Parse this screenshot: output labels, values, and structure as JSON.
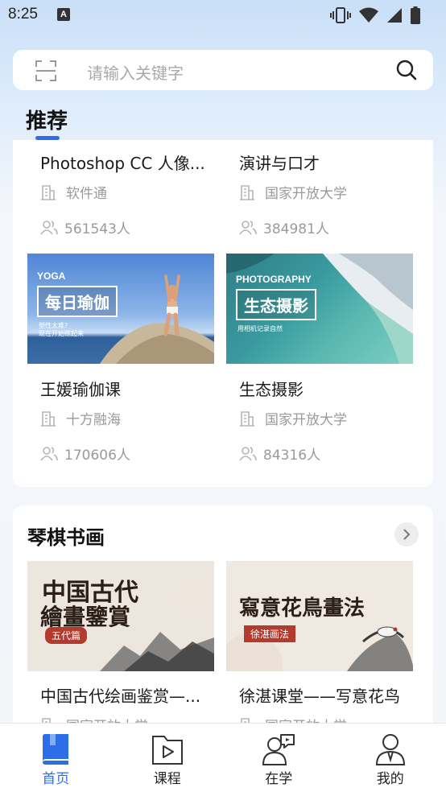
{
  "status_bar": {
    "time": "8:25",
    "notification_badge": "A"
  },
  "search": {
    "placeholder": "请输入关键字"
  },
  "recommend": {
    "title": "推荐",
    "courses": [
      {
        "title": "Photoshop CC 人像...",
        "provider": "软件通",
        "learners": "561543人"
      },
      {
        "title": "演讲与口才",
        "provider": "国家开放大学",
        "learners": "384981人"
      },
      {
        "title": "王媛瑜伽课",
        "provider": "十方融海",
        "learners": "170606人",
        "thumb": {
          "tag": "YOGA",
          "headline": "每日瑜伽",
          "sub1": "塑性太难?",
          "sub2": "现在开始练起来"
        }
      },
      {
        "title": "生态摄影",
        "provider": "国家开放大学",
        "learners": "84316人",
        "thumb": {
          "tag": "PHOTOGRAPHY",
          "headline": "生态摄影",
          "sub1": "用相机记录自然"
        }
      }
    ]
  },
  "qinqi": {
    "title": "琴棋书画",
    "courses": [
      {
        "title": "中国古代绘画鉴赏—...",
        "provider": "国家开放大学",
        "thumb": {
          "line1": "中国古代",
          "line2": "繪畫鑒賞",
          "badge": "五代篇"
        }
      },
      {
        "title": "徐湛课堂——写意花鸟",
        "provider": "国家开放大学",
        "thumb": {
          "line1": "寫意花鳥畫法",
          "badge": "徐湛画法"
        }
      }
    ]
  },
  "tabs": [
    {
      "label": "首页",
      "icon": "book-icon",
      "active": true
    },
    {
      "label": "课程",
      "icon": "video-folder-icon",
      "active": false
    },
    {
      "label": "在学",
      "icon": "learner-chat-icon",
      "active": false
    },
    {
      "label": "我的",
      "icon": "profile-icon",
      "active": false
    }
  ],
  "colors": {
    "accent": "#2d6ee8",
    "muted": "#9a9a9a"
  }
}
